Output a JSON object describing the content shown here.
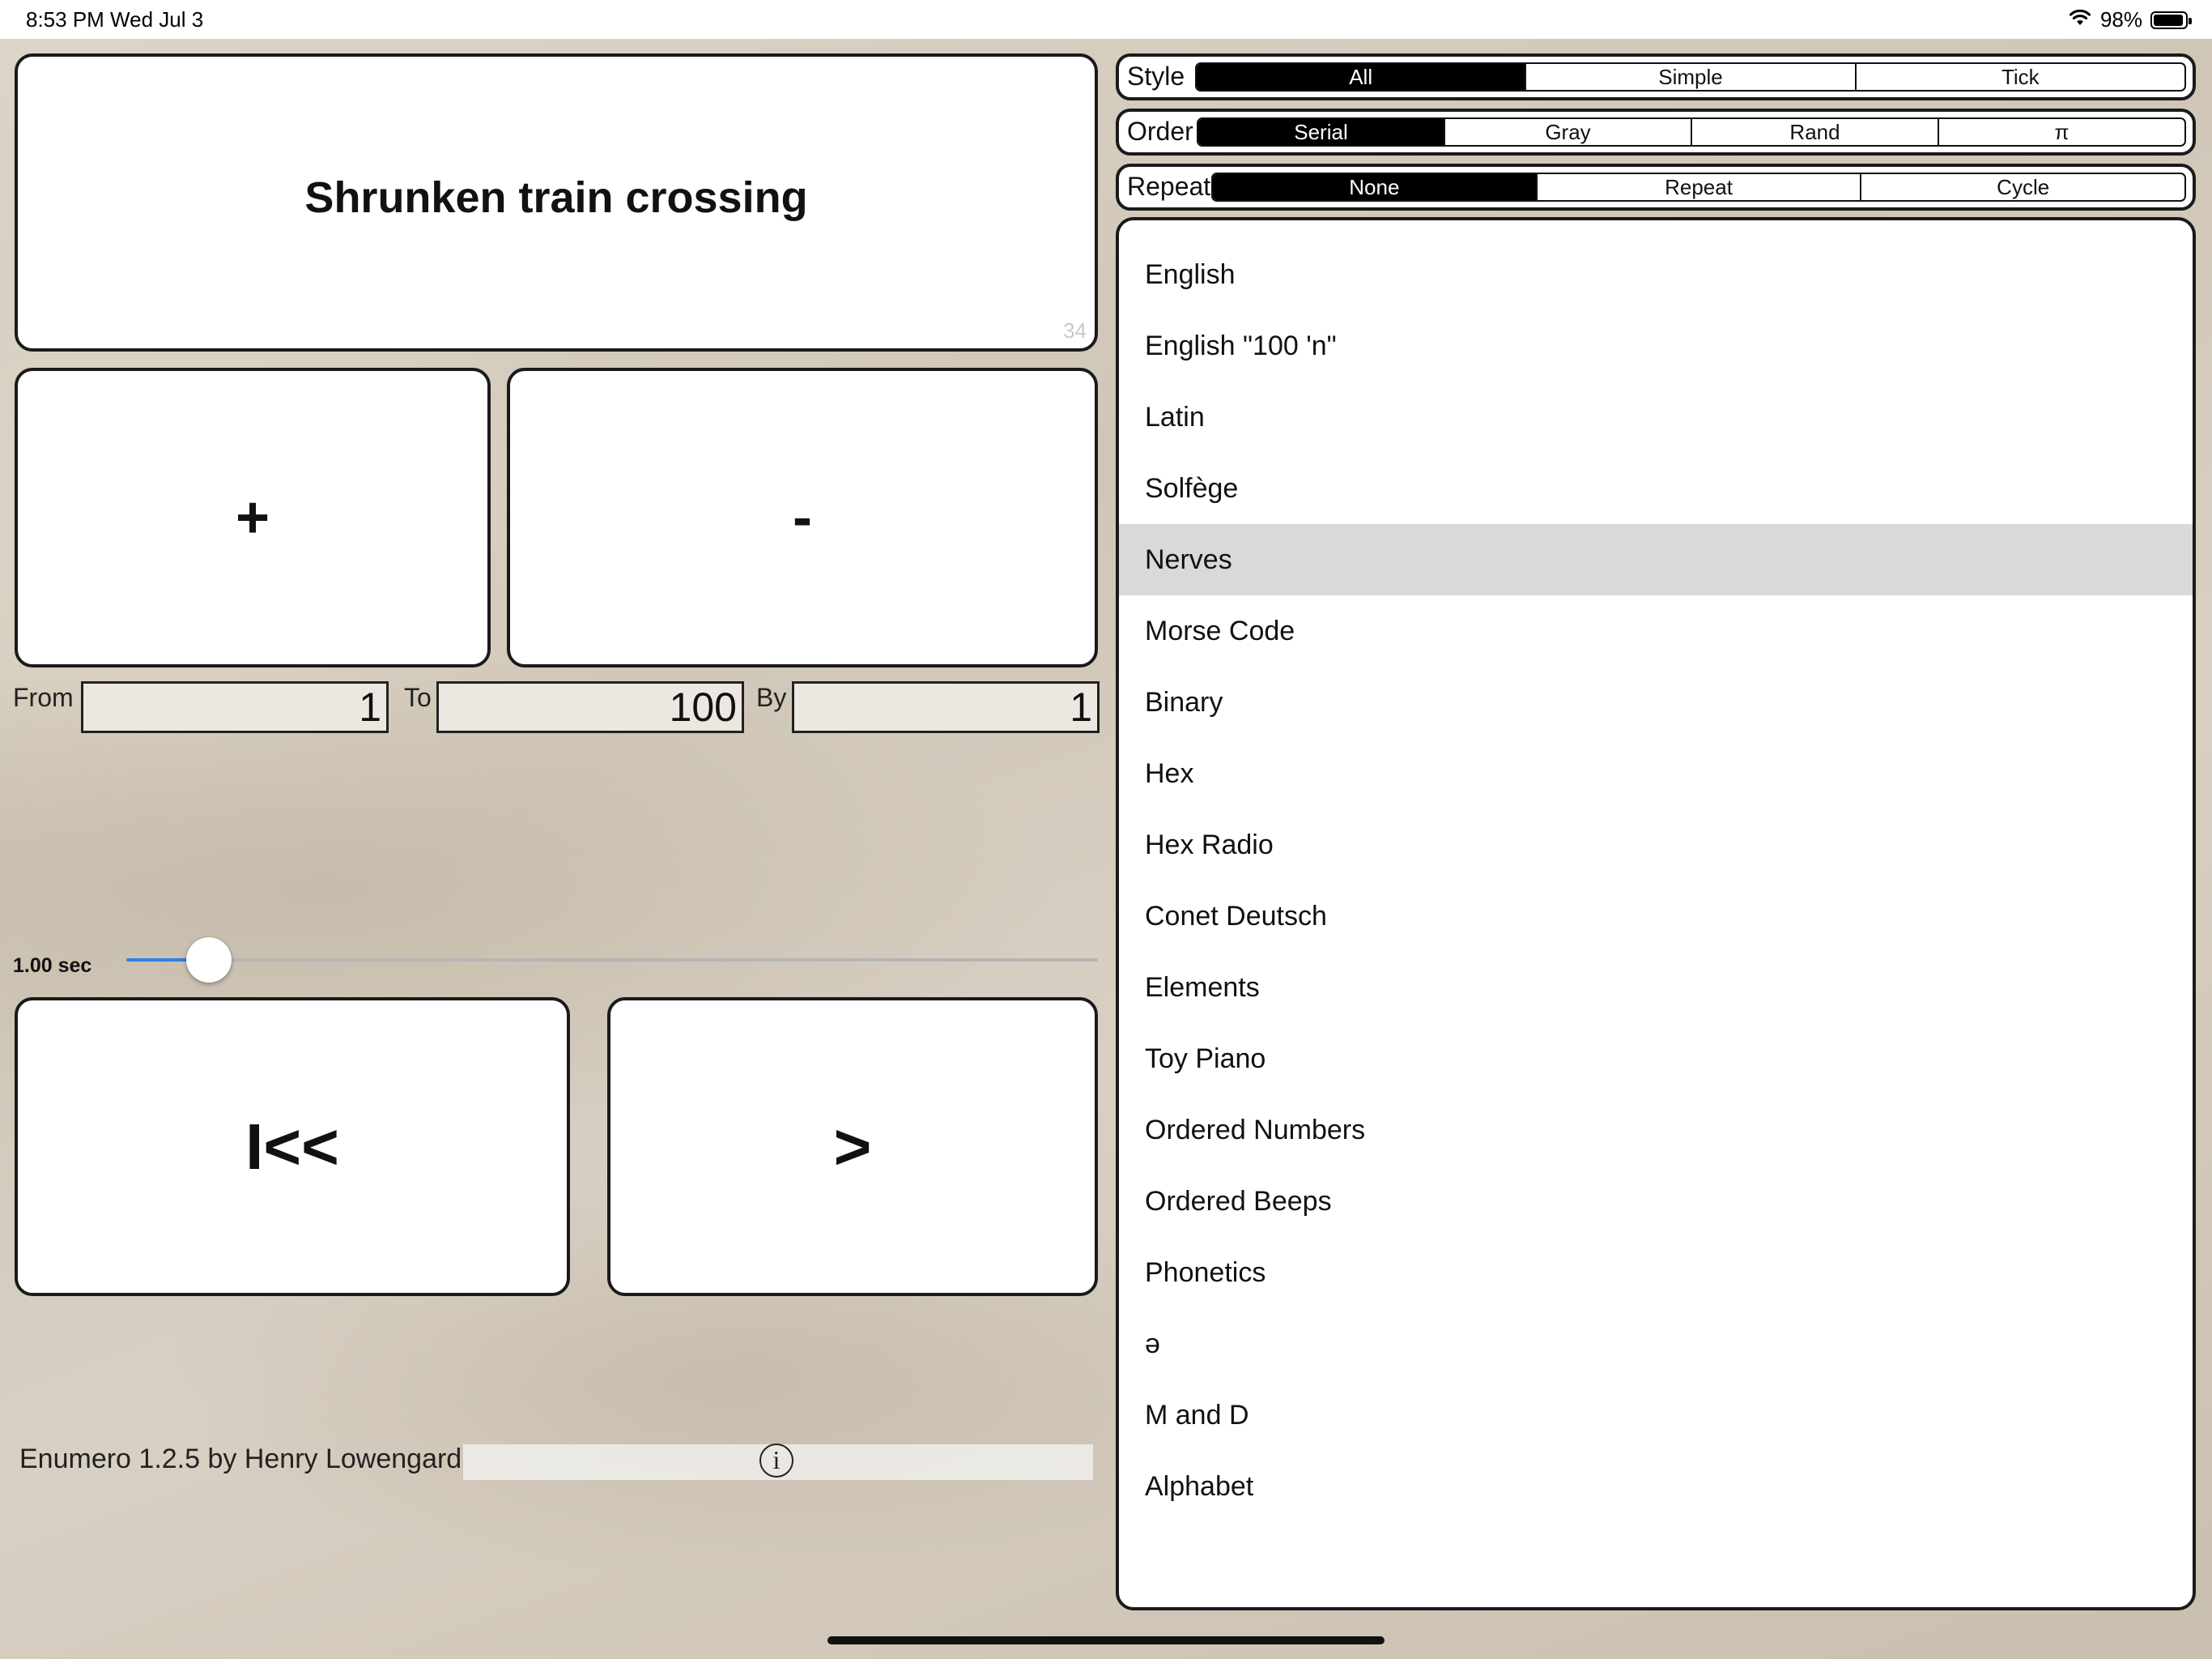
{
  "status_bar": {
    "time": "8:53 PM   Wed Jul 3",
    "battery": "98%"
  },
  "display": {
    "text": "Shrunken train crossing",
    "count": "34"
  },
  "buttons": {
    "plus": "+",
    "minus": "-",
    "rewind": "I<<",
    "play": ">"
  },
  "range": {
    "from_label": "From",
    "from_value": "1",
    "to_label": "To",
    "to_value": "100",
    "by_label": "By",
    "by_value": "1"
  },
  "speed": {
    "label": "1.00 sec",
    "fraction": 0.085
  },
  "footer": {
    "text": "Enumero 1.2.5 by Henry Lowengard",
    "info_glyph": "i"
  },
  "style": {
    "label": "Style",
    "options": [
      "All",
      "Simple",
      "Tick"
    ],
    "selected": 0
  },
  "order": {
    "label": "Order",
    "options": [
      "Serial",
      "Gray",
      "Rand",
      "π"
    ],
    "selected": 0
  },
  "repeat": {
    "label": "Repeat",
    "options": [
      "None",
      "Repeat",
      "Cycle"
    ],
    "selected": 0
  },
  "list": {
    "selected_index": 4,
    "items": [
      "English",
      "English \"100 'n\"",
      "Latin",
      "Solfège",
      "Nerves",
      "Morse Code",
      "Binary",
      "Hex",
      "Hex Radio",
      "Conet Deutsch",
      "Elements",
      "Toy Piano",
      "Ordered Numbers",
      "Ordered Beeps",
      "Phonetics",
      "ə",
      "M and D",
      "Alphabet"
    ]
  },
  "colors": {
    "accent": "#2f7fe6",
    "selected_row": "#d9d9d9",
    "segment_selected": "#000000"
  }
}
